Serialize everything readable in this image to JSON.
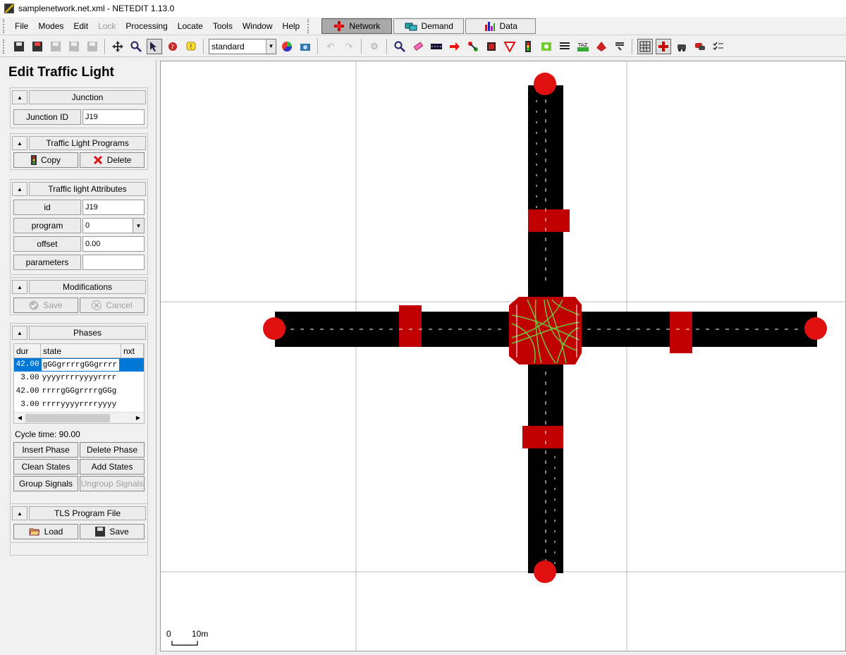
{
  "window": {
    "title": "samplenetwork.net.xml - NETEDIT 1.13.0"
  },
  "menu": {
    "items": [
      "File",
      "Modes",
      "Edit",
      "Lock",
      "Processing",
      "Locate",
      "Tools",
      "Window",
      "Help"
    ],
    "supermodes": [
      "Network",
      "Demand",
      "Data"
    ]
  },
  "toolbar": {
    "view_scheme": "standard"
  },
  "panel": {
    "title": "Edit Traffic Light",
    "junction": {
      "header": "Junction",
      "id_label": "Junction ID",
      "id_value": "J19"
    },
    "programs": {
      "header": "Traffic Light Programs",
      "copy_label": "Copy",
      "delete_label": "Delete"
    },
    "attributes": {
      "header": "Traffic light Attributes",
      "id_label": "id",
      "id_value": "J19",
      "program_label": "program",
      "program_value": "0",
      "offset_label": "offset",
      "offset_value": "0.00",
      "parameters_label": "parameters",
      "parameters_value": ""
    },
    "modifications": {
      "header": "Modifications",
      "save_label": "Save",
      "cancel_label": "Cancel"
    },
    "phases": {
      "header": "Phases",
      "columns": [
        "dur",
        "state",
        "nxt"
      ],
      "rows": [
        {
          "dur": "42.00",
          "state": "gGGgrrrrgGGgrrrr",
          "nxt": ""
        },
        {
          "dur": "3.00",
          "state": "yyyyrrrryyyyrrrr",
          "nxt": ""
        },
        {
          "dur": "42.00",
          "state": "rrrrgGGgrrrrgGGg",
          "nxt": ""
        },
        {
          "dur": "3.00",
          "state": "rrrryyyyrrrryyyy",
          "nxt": ""
        }
      ],
      "cycle_time": "Cycle time: 90.00",
      "insert_phase": "Insert Phase",
      "delete_phase": "Delete Phase",
      "clean_states": "Clean States",
      "add_states": "Add States",
      "group_signals": "Group Signals",
      "ungroup_signals": "Ungroup Signals"
    },
    "tls_file": {
      "header": "TLS Program File",
      "load_label": "Load",
      "save_label": "Save"
    }
  },
  "canvas": {
    "scale_zero": "0",
    "scale_label": "10m"
  },
  "colors": {
    "road": "#000000",
    "junction_red": "#c00000",
    "node_red": "#e01010",
    "connection_green": "#6fc43a",
    "selection_blue": "#0078d7"
  }
}
